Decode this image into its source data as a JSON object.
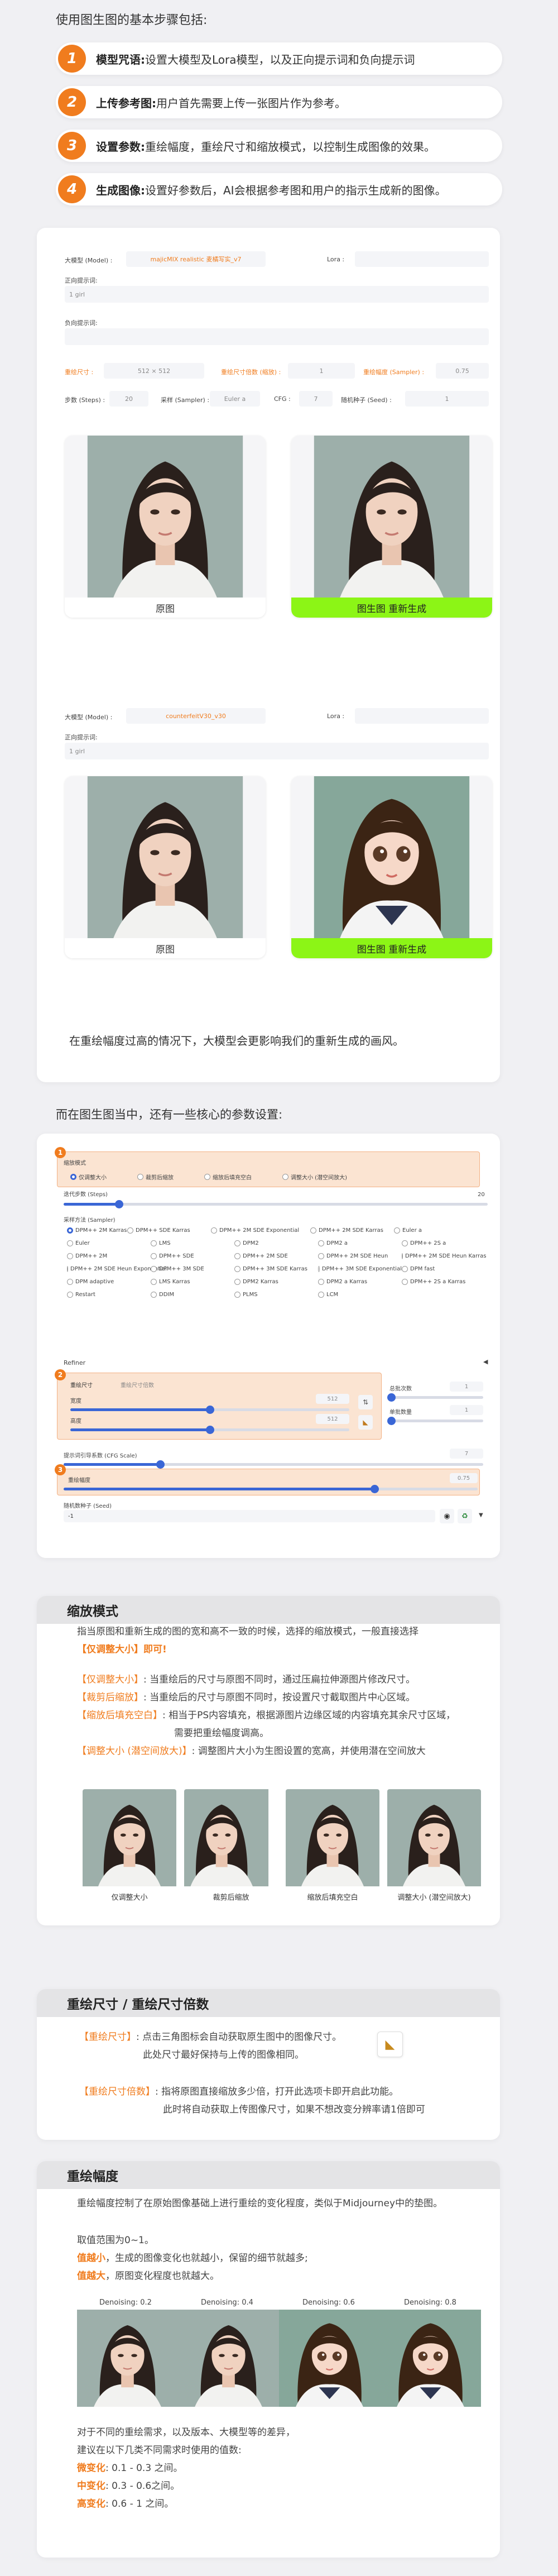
{
  "intro": {
    "title": "使用图生图的基本步骤包括:",
    "steps": [
      {
        "num": "1",
        "label": "模型咒语:",
        "text": "设置大模型及Lora模型，以及正向提示词和负向提示词"
      },
      {
        "num": "2",
        "label": "上传参考图:",
        "text": "用户首先需要上传一张图片作为参考。"
      },
      {
        "num": "3",
        "label": "设置参数:",
        "text": "重绘幅度，重绘尺寸和缩放模式，以控制生成图像的效果。"
      },
      {
        "num": "4",
        "label": "生成图像:",
        "text": "设置好参数后，AI会根据参考图和用户的指示生成新的图像。"
      }
    ]
  },
  "example1": {
    "model_label": "大模型 (Model) :",
    "model_value": "majicMIX realistic 麦橘写实_v7",
    "lora_label": "Lora :",
    "pos_label": "正向提示词:",
    "pos_value": "1 girl",
    "neg_label": "负向提示词:",
    "size_label": "重绘尺寸 :",
    "size_value": "512 × 512",
    "ratio_label": "重绘尺寸倍数 (缩放) :",
    "ratio_value": "1",
    "denoise_label": "重绘幅度 (Sampler) :",
    "denoise_value": "0.75",
    "steps_label": "步数 (Steps) :",
    "steps_value": "20",
    "sampler_label": "采样 (Sampler) :",
    "sampler_value": "Euler a",
    "cfg_label": "CFG :",
    "cfg_value": "7",
    "seed_label": "随机种子 (Seed) :",
    "seed_value": "1",
    "cap_original": "原图",
    "cap_new": "图生图 重新生成"
  },
  "example2": {
    "model_label": "大模型 (Model) :",
    "model_value": "counterfeitV30_v30",
    "lora_label": "Lora :",
    "pos_label": "正向提示词:",
    "pos_value": "1 girl",
    "cap_original": "原图",
    "cap_new": "图生图 重新生成",
    "note": "在重绘幅度过高的情况下，大模型会更影响我们的重新生成的画风。"
  },
  "params": {
    "title": "而在图生图当中，还有一些核心的参数设置:",
    "resize_label": "缩放模式",
    "resize_options": [
      "仅调整大小",
      "裁剪后缩放",
      "缩放后填充空白",
      "调整大小 (潜空间放大)"
    ],
    "steps_label": "迭代步数 (Steps)",
    "steps_value": "20",
    "sampler_label": "采样方法 (Sampler)",
    "samplers": [
      "DPM++ 2M Karras",
      "DPM++ SDE Karras",
      "DPM++ 2M SDE Exponential",
      "DPM++ 2M SDE Karras",
      "Euler a",
      "Euler",
      "LMS",
      "DPM2",
      "DPM2 a",
      "DPM++ 2S a",
      "DPM++ 2M",
      "DPM++ SDE",
      "DPM++ 2M SDE",
      "DPM++ 2M SDE Heun",
      "DPM++ 2M SDE Heun Karras",
      "DPM++ 2M SDE Heun Exponential",
      "DPM++ 3M SDE",
      "DPM++ 3M SDE Karras",
      "DPM++ 3M SDE Exponential",
      "DPM fast",
      "DPM adaptive",
      "LMS Karras",
      "DPM2 Karras",
      "DPM2 a Karras",
      "DPM++ 2S a Karras",
      "Restart",
      "DDIM",
      "PLMS",
      "LCM"
    ],
    "refiner_label": "Refiner",
    "tab_resize": "重绘尺寸",
    "tab_scale": "重绘尺寸倍数",
    "width_label": "宽度",
    "width_value": "512",
    "height_label": "高度",
    "height_value": "512",
    "batch_count_label": "总批次数",
    "batch_count_value": "1",
    "batch_size_label": "单批数量",
    "batch_size_value": "1",
    "cfg_label": "提示词引导系数 (CFG Scale)",
    "cfg_value": "7",
    "denoise_label": "重绘幅度",
    "denoise_value": "0.75",
    "seed_label": "随机数种子 (Seed)",
    "seed_value": "-1",
    "badges": [
      "1",
      "2",
      "3"
    ],
    "steps_fraction": 0.13,
    "cfg_fraction": 0.23,
    "denoise_fraction": 0.75
  },
  "resize_section": {
    "title": "缩放模式",
    "line1": "指当原图和重新生成的图的宽和高不一致的时候，选择的缩放模式，一般直接选择",
    "line2": "【仅调整大小】即可!",
    "items": [
      {
        "tag": "【仅调整大小】",
        "text": ": 当重绘后的尺寸与原图不同时，通过压扁拉伸源图片修改尺寸。"
      },
      {
        "tag": "【裁剪后缩放】",
        "text": ": 当重绘后的尺寸与原图不同时，按设置尺寸截取图片中心区域。"
      },
      {
        "tag": "【缩放后填充空白】",
        "text": ": 相当于PS内容填充，根据源图片边缘区域的内容填充其余尺寸区域，"
      },
      {
        "tag": "",
        "text": "需要把重绘幅度调高。"
      },
      {
        "tag": "【调整大小 (潜空间放大)】",
        "text": ": 调整图片大小为生图设置的宽高，并使用潜在空间放大"
      }
    ],
    "captions": [
      "仅调整大小",
      "裁剪后缩放",
      "缩放后填充空白",
      "调整大小 (潜空间放大)"
    ]
  },
  "size_section": {
    "title": "重绘尺寸 / 重绘尺寸倍数",
    "a_tag": "【重绘尺寸】",
    "a_text": ": 点击三角图标会自动获取原生图中的图像尺寸。",
    "a_text2": "此处尺寸最好保持与上传的图像相同。",
    "b_tag": "【重绘尺寸倍数】",
    "b_text": ": 指将原图直接缩放多少倍，打开此选项卡即开启此功能。",
    "b_text2": "此时将自动获取上传图像尺寸，如果不想改变分辨率请1倍即可"
  },
  "denoise_section": {
    "title": "重绘幅度",
    "line1": "重绘幅度控制了在原始图像基础上进行重绘的变化程度，类似于Midjourney中的垫图。",
    "line2": "取值范围为0~1。",
    "small_tag": "值越小",
    "small_text": "，生成的图像变化也就越小，保留的细节就越多;",
    "big_tag": "值越大",
    "big_text": "，原图变化程度也就越大。",
    "labels": [
      "Denoising: 0.2",
      "Denoising: 0.4",
      "Denoising: 0.6",
      "Denoising: 0.8"
    ],
    "tip1": "对于不同的重绘需求，以及版本、大模型等的差异，",
    "tip2": "建议在以下几类不同需求时使用的值数:",
    "r1_tag": "微变化",
    "r1_text": ": 0.1 - 0.3 之间。",
    "r2_tag": "中变化",
    "r2_text": ": 0.3 - 0.6之间。",
    "r3_tag": "高变化",
    "r3_text": ": 0.6 - 1 之间。"
  }
}
